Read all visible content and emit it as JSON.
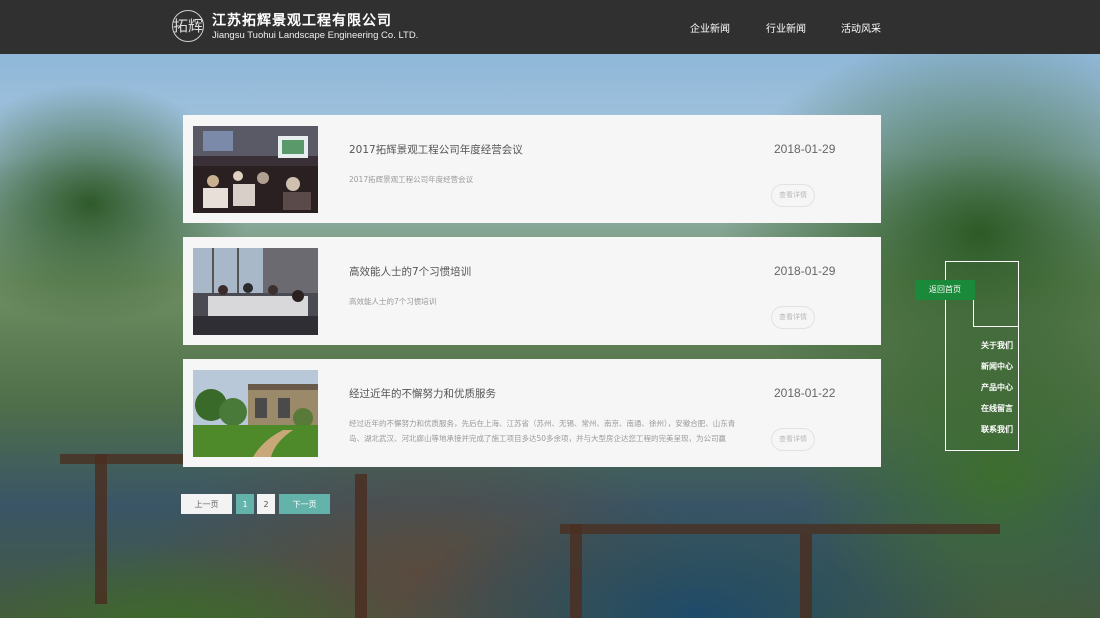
{
  "header": {
    "logo_mark": "拓辉",
    "company_cn": "江苏拓辉景观工程有限公司",
    "company_en": "Jiangsu Tuohui Landscape Engineering Co. LTD.",
    "nav": [
      "企业新闻",
      "行业新闻",
      "活动风采"
    ]
  },
  "news": [
    {
      "title": "2017拓辉景观工程公司年度经营会议",
      "summary": "2017拓辉景观工程公司年度经营会议",
      "date": "2018-01-29",
      "more": "查看详情"
    },
    {
      "title": "高效能人士的7个习惯培训",
      "summary": "高效能人士的7个习惯培训",
      "date": "2018-01-29",
      "more": "查看详情"
    },
    {
      "title": "经过近年的不懈努力和优质服务",
      "summary": "经过近年的不懈努力和优质服务，先后在上海、江苏省（苏州、无锡、常州、南京、南通、徐州），安徽合肥、山东青岛、湖北武汉、河北廊山等地承接并完成了施工项目多达50多余项，并与大型房企达您工程的完美呈现，为公司赢",
      "date": "2018-01-22",
      "more": "查看详情"
    }
  ],
  "pagination": {
    "prev": "上一页",
    "pages": [
      "1",
      "2"
    ],
    "current": "1",
    "next": "下一页"
  },
  "side_menu": {
    "home": "返回首页",
    "items": [
      "关于我们",
      "新闻中心",
      "产品中心",
      "在线留言",
      "联系我们"
    ]
  },
  "colors": {
    "header_bg": "#303030",
    "accent_teal": "#63b3aa",
    "home_green": "#1a8a3a"
  }
}
